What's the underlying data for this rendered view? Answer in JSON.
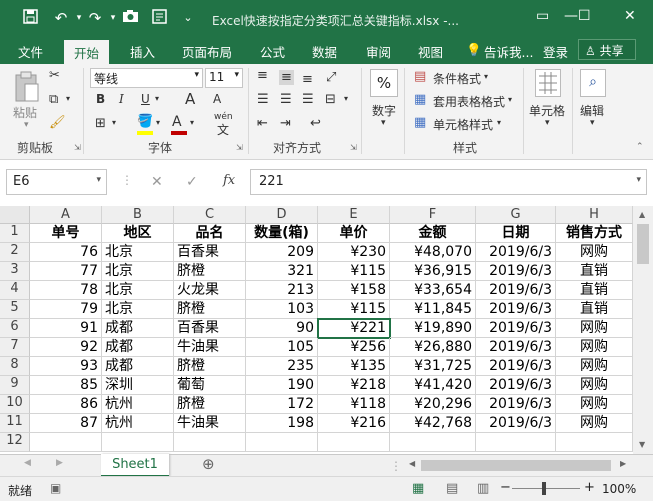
{
  "quick_access": {
    "save_icon": "save-icon",
    "undo_icon": "undo-icon",
    "redo_icon": "redo-icon",
    "camera_icon": "camera-icon",
    "form_icon": "form-icon",
    "more": "⌄"
  },
  "title": "Excel快速按指定分类项汇总关键指标.xlsx -...",
  "tabs": [
    "文件",
    "开始",
    "插入",
    "页面布局",
    "公式",
    "数据",
    "审阅",
    "视图"
  ],
  "active_tab": "开始",
  "tell_me": "告诉我...",
  "login": "登录",
  "share": "共享",
  "ribbon": {
    "clipboard": {
      "paste": "粘贴",
      "label": "剪贴板"
    },
    "font": {
      "name": "等线",
      "size": "11",
      "label": "字体",
      "bold": "B",
      "italic": "I",
      "underline": "U",
      "wen": "wén",
      "wen_char": "文",
      "grow": "A",
      "shrink": "A",
      "font_color": "A"
    },
    "alignment": {
      "label": "对齐方式"
    },
    "number": {
      "button": "数字",
      "symbol": "%"
    },
    "styles": {
      "conditional": "条件格式",
      "table": "套用表格格式",
      "cell": "单元格样式",
      "label": "样式"
    },
    "cells": {
      "button": "单元格"
    },
    "editing": {
      "button": "编辑"
    }
  },
  "formula_bar": {
    "name_box": "E6",
    "fx": "fx",
    "value": "221",
    "cancel": "✕",
    "enter": "✓"
  },
  "columns": [
    "A",
    "B",
    "C",
    "D",
    "E",
    "F",
    "G",
    "H"
  ],
  "rows": [
    "1",
    "2",
    "3",
    "4",
    "5",
    "6",
    "7",
    "8",
    "9",
    "10",
    "11",
    "12"
  ],
  "headers": [
    "单号",
    "地区",
    "品名",
    "数量(箱)",
    "单价",
    "金额",
    "日期",
    "销售方式"
  ],
  "data": [
    [
      "76",
      "北京",
      "百香果",
      "209",
      "¥230",
      "¥48,070",
      "2019/6/3",
      "网购"
    ],
    [
      "77",
      "北京",
      "脐橙",
      "321",
      "¥115",
      "¥36,915",
      "2019/6/3",
      "直销"
    ],
    [
      "78",
      "北京",
      "火龙果",
      "213",
      "¥158",
      "¥33,654",
      "2019/6/3",
      "直销"
    ],
    [
      "79",
      "北京",
      "脐橙",
      "103",
      "¥115",
      "¥11,845",
      "2019/6/3",
      "直销"
    ],
    [
      "91",
      "成都",
      "百香果",
      "90",
      "¥221",
      "¥19,890",
      "2019/6/3",
      "网购"
    ],
    [
      "92",
      "成都",
      "牛油果",
      "105",
      "¥256",
      "¥26,880",
      "2019/6/3",
      "网购"
    ],
    [
      "93",
      "成都",
      "脐橙",
      "235",
      "¥135",
      "¥31,725",
      "2019/6/3",
      "网购"
    ],
    [
      "85",
      "深圳",
      "葡萄",
      "190",
      "¥218",
      "¥41,420",
      "2019/6/3",
      "网购"
    ],
    [
      "86",
      "杭州",
      "脐橙",
      "172",
      "¥118",
      "¥20,296",
      "2019/6/3",
      "网购"
    ],
    [
      "87",
      "杭州",
      "牛油果",
      "198",
      "¥216",
      "¥42,768",
      "2019/6/3",
      "网购"
    ]
  ],
  "sheet_tab": "Sheet1",
  "add_sheet": "⊕",
  "status": {
    "ready": "就绪",
    "zoom": "100%",
    "minus": "−",
    "plus": "+"
  },
  "colors": {
    "brand": "#217346",
    "grid_line": "#d4d4d4"
  }
}
